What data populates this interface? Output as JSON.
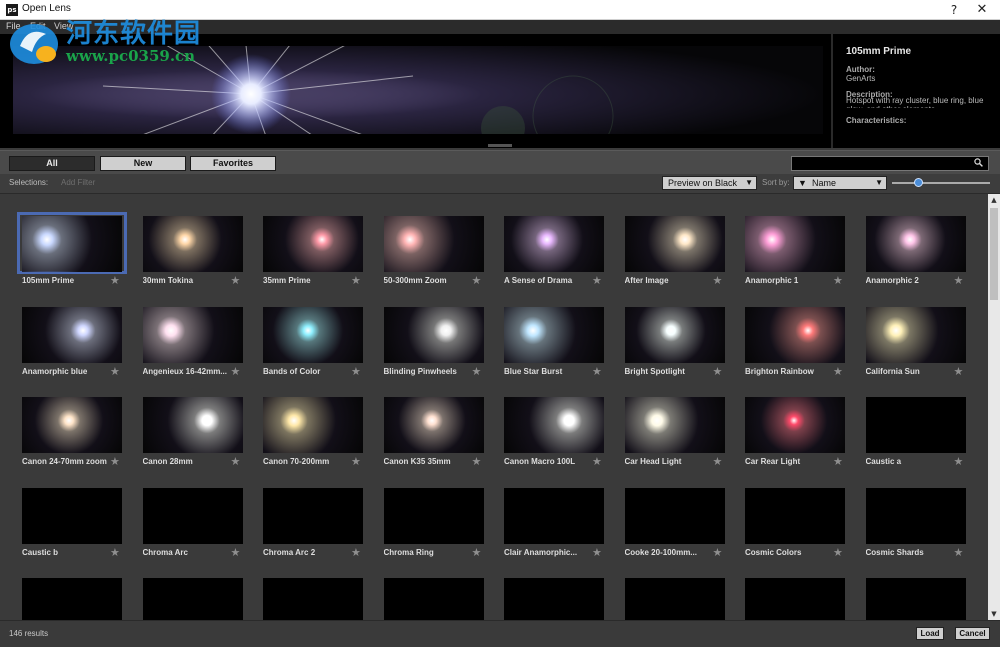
{
  "window": {
    "title": "Open Lens",
    "help_glyph": "?",
    "close_glyph": "✕",
    "app_icon_text": "ps"
  },
  "menu": [
    "File",
    "Edit",
    "View"
  ],
  "watermark": {
    "chinese": "河东软件园",
    "url": "www.pc0359.cn"
  },
  "details": {
    "name": "105mm Prime",
    "author_label": "Author:",
    "author": "GenArts",
    "description_label": "Description:",
    "description": "Hotspot with ray cluster, blue ring, blue glow, and other elements",
    "characteristics_label": "Characteristics:"
  },
  "tabs": {
    "all": "All",
    "new": "New",
    "favorites": "Favorites"
  },
  "search": {
    "value": ""
  },
  "filters": {
    "selections_label": "Selections:",
    "add_filter": "Add Filter",
    "preview_mode": "Preview on Black",
    "sort_by_label": "Sort by:",
    "sort_value": "Name",
    "sort_dir_icon": "▼"
  },
  "size_slider_value": 0.25,
  "lenses": [
    {
      "name": "105mm Prime",
      "color": "#c9d8ff"
    },
    {
      "name": "30mm Tokina",
      "color": "#ffd7a8"
    },
    {
      "name": "35mm Prime",
      "color": "#ff9aa8"
    },
    {
      "name": "50-300mm Zoom",
      "color": "#ffb3b3"
    },
    {
      "name": "A Sense of Drama",
      "color": "#e9b8ff"
    },
    {
      "name": "After Image",
      "color": "#ffe8c8"
    },
    {
      "name": "Anamorphic 1",
      "color": "#ff9fd8"
    },
    {
      "name": "Anamorphic 2",
      "color": "#ffc4e8"
    },
    {
      "name": "Anamorphic blue",
      "color": "#cfd6ff"
    },
    {
      "name": "Angenieux 16-42mm...",
      "color": "#ffe0f0"
    },
    {
      "name": "Bands of Color",
      "color": "#8ff0ff"
    },
    {
      "name": "Blinding Pinwheels",
      "color": "#f0f0f0"
    },
    {
      "name": "Blue Star Burst",
      "color": "#bfe6ff"
    },
    {
      "name": "Bright Spotlight",
      "color": "#f6ffff"
    },
    {
      "name": "Brighton Rainbow",
      "color": "#ff7a7a"
    },
    {
      "name": "California Sun",
      "color": "#fff1b8"
    },
    {
      "name": "Canon 24-70mm zoom",
      "color": "#ffe4c8"
    },
    {
      "name": "Canon 28mm",
      "color": "#ffffff"
    },
    {
      "name": "Canon 70-200mm",
      "color": "#ffe8a8"
    },
    {
      "name": "Canon K35 35mm",
      "color": "#ffe0d0"
    },
    {
      "name": "Canon Macro 100L",
      "color": "#ffffff"
    },
    {
      "name": "Car Head Light",
      "color": "#fffbe8"
    },
    {
      "name": "Car Rear Light",
      "color": "#ff4a6a"
    },
    {
      "name": "Caustic a",
      "color": ""
    },
    {
      "name": "Caustic b",
      "color": ""
    },
    {
      "name": "Chroma Arc",
      "color": ""
    },
    {
      "name": "Chroma Arc 2",
      "color": ""
    },
    {
      "name": "Chroma Ring",
      "color": ""
    },
    {
      "name": "Clair Anamorphic...",
      "color": ""
    },
    {
      "name": "Cooke 20-100mm...",
      "color": ""
    },
    {
      "name": "Cosmic Colors",
      "color": ""
    },
    {
      "name": "Cosmic Shards",
      "color": ""
    },
    {
      "name": "",
      "color": ""
    },
    {
      "name": "",
      "color": ""
    },
    {
      "name": "",
      "color": ""
    },
    {
      "name": "",
      "color": ""
    },
    {
      "name": "",
      "color": ""
    },
    {
      "name": "",
      "color": ""
    },
    {
      "name": "",
      "color": ""
    },
    {
      "name": "",
      "color": ""
    }
  ],
  "selected_index": 0,
  "scroll": {
    "up_glyph": "▲",
    "down_glyph": "▼"
  },
  "status": {
    "results": "146 results"
  },
  "footer": {
    "load": "Load",
    "cancel": "Cancel"
  }
}
